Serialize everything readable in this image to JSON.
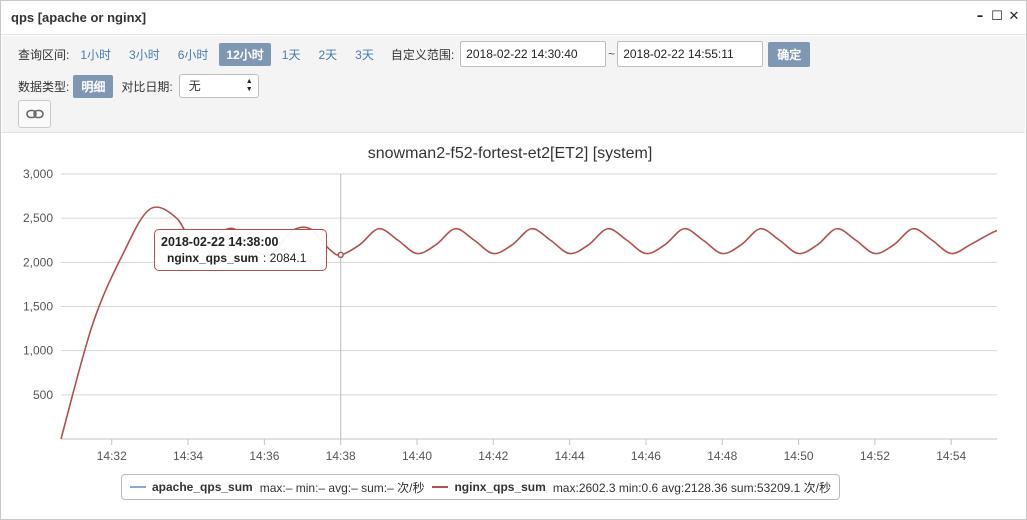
{
  "window": {
    "title": "qps [apache or nginx]"
  },
  "toolbar": {
    "range_label": "查询区间:",
    "ranges": [
      "1小时",
      "3小时",
      "6小时",
      "12小时",
      "1天",
      "2天",
      "3天"
    ],
    "custom_label": "自定义范围:",
    "start": "2018-02-22 14:30:40",
    "tilde": "~",
    "end": "2018-02-22 14:55:11",
    "confirm": "确定",
    "type_label": "数据类型:",
    "type_value": "明细",
    "compare_label": "对比日期:",
    "compare_value": "无"
  },
  "tooltip": {
    "time": "2018-02-22 14:38:00",
    "series": "nginx_qps_sum",
    "value": ": 2084.1"
  },
  "legend": [
    {
      "name": "apache_qps_sum",
      "stats": "max:– min:– avg:– sum:– 次/秒",
      "color": "#8aa8c7"
    },
    {
      "name": "nginx_qps_sum",
      "stats": "max:2602.3 min:0.6 avg:2128.36 sum:53209.1 次/秒",
      "color": "#b0514f"
    }
  ],
  "chart_data": {
    "type": "line",
    "title": "snowman2-f52-fortest-et2[ET2] [system]",
    "x_ticks": [
      "14:32",
      "14:34",
      "14:36",
      "14:38",
      "14:40",
      "14:42",
      "14:44",
      "14:46",
      "14:48",
      "14:50",
      "14:52",
      "14:54"
    ],
    "y_ticks": [
      "500",
      "1,000",
      "1,500",
      "2,000",
      "2,500",
      "3,000"
    ],
    "ylim": [
      0,
      3000
    ],
    "series": [
      {
        "name": "apache_qps_sum",
        "color": "#8aa8c7",
        "values": []
      },
      {
        "name": "nginx_qps_sum",
        "color": "#b0514f",
        "x": [
          30.67,
          31.5,
          32.3,
          33.0,
          33.7,
          34.2,
          34.7,
          35.2,
          35.7,
          36.2,
          36.7,
          37.2,
          37.7,
          38.0,
          38.5,
          39.0,
          39.5,
          40.0,
          40.5,
          41.0,
          41.5,
          42.0,
          42.5,
          43.0,
          43.5,
          44.0,
          44.5,
          45.0,
          45.5,
          46.0,
          46.5,
          47.0,
          47.5,
          48.0,
          48.5,
          49.0,
          49.5,
          50.0,
          50.5,
          51.0,
          51.5,
          52.0,
          52.5,
          53.0,
          53.5,
          54.0,
          54.5,
          55.0,
          55.2
        ],
        "y": [
          0.6,
          1300,
          2100,
          2602.3,
          2500,
          2150,
          2300,
          2380,
          2150,
          2100,
          2350,
          2380,
          2150,
          2084.1,
          2200,
          2380,
          2250,
          2100,
          2200,
          2380,
          2250,
          2100,
          2200,
          2380,
          2250,
          2100,
          2200,
          2380,
          2250,
          2100,
          2200,
          2380,
          2250,
          2100,
          2200,
          2380,
          2250,
          2100,
          2200,
          2380,
          2250,
          2100,
          2200,
          2380,
          2250,
          2100,
          2200,
          2320,
          2360
        ]
      }
    ]
  }
}
